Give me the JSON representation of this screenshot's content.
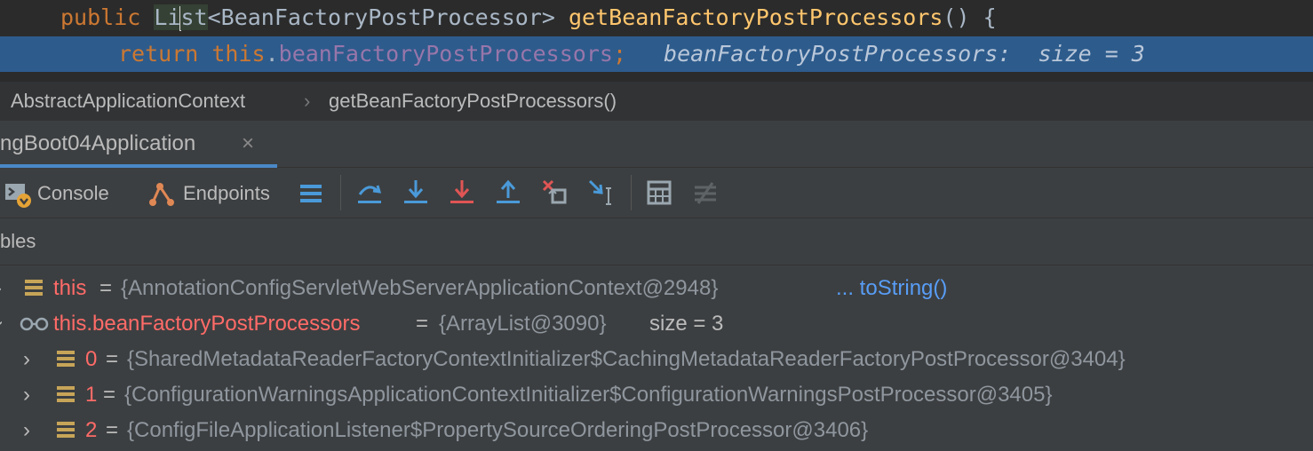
{
  "editor": {
    "line1": {
      "kw_public": "public",
      "type_pre": "Li",
      "type_post": "st",
      "generic": "<BeanFactoryPostProcessor> ",
      "method": "getBeanFactoryPostProcessors",
      "tail": "() {"
    },
    "line2": {
      "kw_return": "return",
      "kw_this": "this",
      "dot": ".",
      "field": "beanFactoryPostProcessors",
      "semi": ";",
      "hint": "beanFactoryPostProcessors:  size = 3"
    }
  },
  "breadcrumb": {
    "class_name": "AbstractApplicationContext",
    "separator": "›",
    "method_name": "getBeanFactoryPostProcessors()"
  },
  "run_tab": {
    "label": "ngBoot04Application",
    "close": "×"
  },
  "toolbar": {
    "console_label": "Console",
    "endpoints_label": "Endpoints"
  },
  "variables": {
    "title": "bles",
    "rows": [
      {
        "name": "this",
        "eq": "=",
        "value": "{AnnotationConfigServletWebServerApplicationContext@2948}",
        "link": "... toString()"
      },
      {
        "name": "this.beanFactoryPostProcessors",
        "eq": "=",
        "value": "{ArrayList@3090}",
        "extra": "size = 3"
      },
      {
        "name": "0",
        "eq": "=",
        "value": "{SharedMetadataReaderFactoryContextInitializer$CachingMetadataReaderFactoryPostProcessor@3404}"
      },
      {
        "name": "1",
        "eq": "=",
        "value": "{ConfigurationWarningsApplicationContextInitializer$ConfigurationWarningsPostProcessor@3405}"
      },
      {
        "name": "2",
        "eq": "=",
        "value": "{ConfigFileApplicationListener$PropertySourceOrderingPostProcessor@3406}"
      }
    ],
    "arrows": {
      "collapsed": "›",
      "expanded": "›"
    }
  },
  "colors": {
    "editor_bg": "#2b2b2b",
    "selected_line": "#2d5b8c",
    "panel_bg": "#3c3f41",
    "keyword": "#cc7832",
    "method": "#ffc66d",
    "field": "#9876aa",
    "var_name": "#ff6b68",
    "link": "#589df6",
    "accent_blue": "#3d8fd6",
    "accent_red": "#e05555"
  }
}
